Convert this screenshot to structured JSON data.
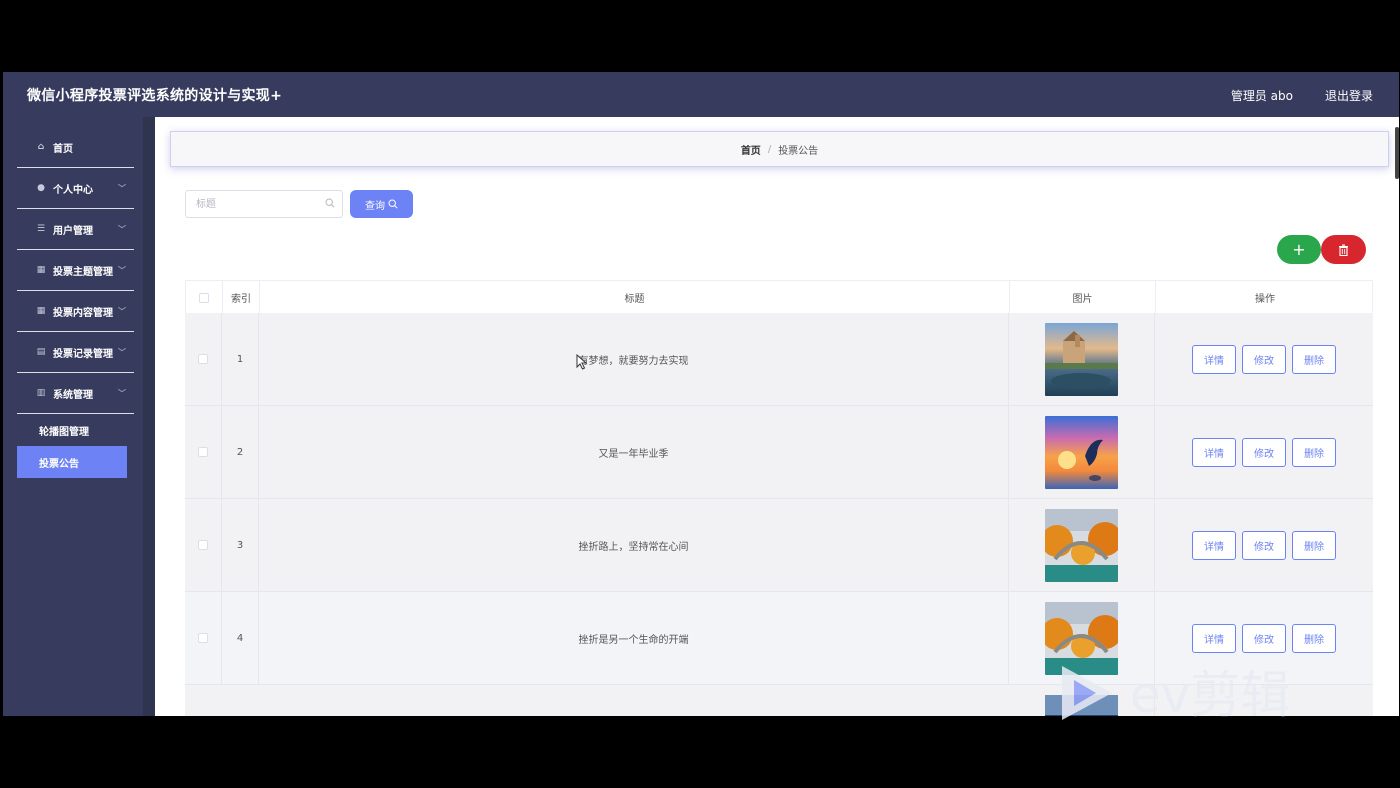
{
  "header": {
    "title": "微信小程序投票评选系统的设计与实现+",
    "admin": "管理员 abo",
    "logout": "退出登录"
  },
  "sidebar": {
    "items": [
      {
        "label": "首页",
        "icon": "home-icon",
        "arrow": false
      },
      {
        "label": "个人中心",
        "icon": "user-icon",
        "arrow": true
      },
      {
        "label": "用户管理",
        "icon": "list-icon",
        "arrow": true
      },
      {
        "label": "投票主题管理",
        "icon": "grid-icon",
        "arrow": true
      },
      {
        "label": "投票内容管理",
        "icon": "grid-icon",
        "arrow": true
      },
      {
        "label": "投票记录管理",
        "icon": "clipboard-icon",
        "arrow": true
      },
      {
        "label": "系统管理",
        "icon": "bar-chart-icon",
        "arrow": true
      }
    ],
    "sub_items": [
      {
        "label": "轮播图管理",
        "active": false
      },
      {
        "label": "投票公告",
        "active": true
      }
    ]
  },
  "breadcrumb": {
    "home": "首页",
    "separator": "/",
    "current": "投票公告"
  },
  "search": {
    "placeholder": "标题",
    "value": "",
    "button": "查询"
  },
  "actions": {
    "add_icon": "plus-icon",
    "delete_icon": "trash-icon"
  },
  "table": {
    "headers": {
      "index": "索引",
      "title": "标题",
      "image": "图片",
      "ops": "操作"
    },
    "rows": [
      {
        "index": "1",
        "title": "有梦想，就要努力去实现",
        "image": "castle-lake-image"
      },
      {
        "index": "2",
        "title": "又是一年毕业季",
        "image": "dolphin-sunset-image"
      },
      {
        "index": "3",
        "title": "挫折路上，坚持常在心间",
        "image": "autumn-bridge-image"
      },
      {
        "index": "4",
        "title": "挫折是另一个生命的开端",
        "image": "autumn-bridge-image"
      }
    ],
    "ops": {
      "detail": "详情",
      "edit": "修改",
      "delete": "删除"
    }
  },
  "watermark": {
    "text": "ev剪辑"
  },
  "colors": {
    "sidebar": "#373c5e",
    "accent": "#6d82f5",
    "add": "#2aa74d",
    "delete": "#d8262e"
  }
}
